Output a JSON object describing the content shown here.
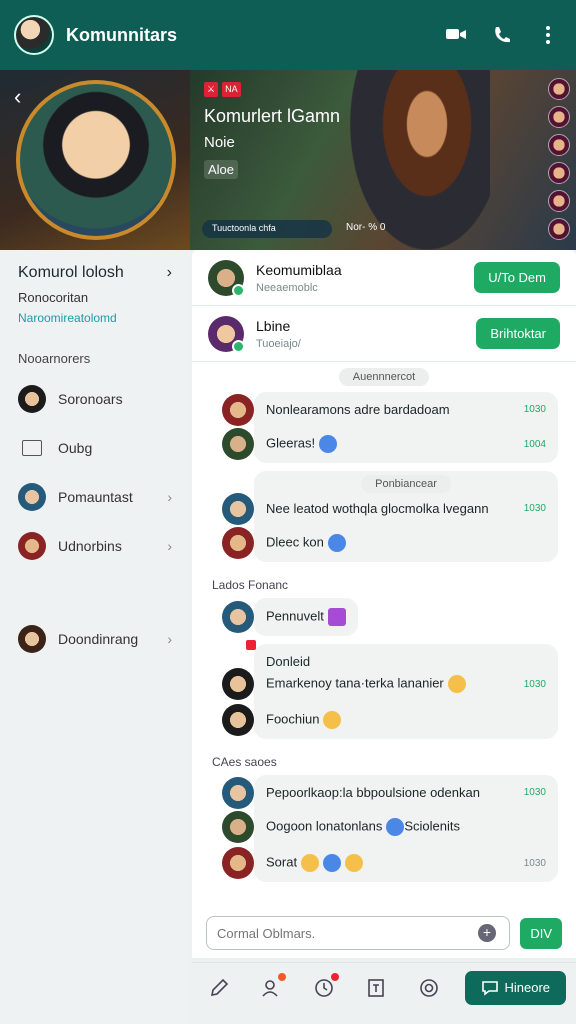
{
  "header": {
    "title": "Komunnitars"
  },
  "profile": {
    "name": "Komurol lolosh",
    "subtitle": "Ronocoritan",
    "link": "Naroomireatolomd",
    "section_title": "Nooarnorers",
    "items": [
      {
        "label": "Soronoars",
        "icon": "avatar",
        "chevron": false
      },
      {
        "label": "Oubg",
        "icon": "square-icon",
        "chevron": false
      },
      {
        "label": "Pomauntast",
        "icon": "avatar",
        "chevron": true
      },
      {
        "label": "Udnorbins",
        "icon": "avatar",
        "chevron": true
      },
      {
        "label": "Doondinrang",
        "icon": "avatar",
        "chevron": true
      }
    ]
  },
  "banner": {
    "badges": [
      "⚔",
      "NA"
    ],
    "title": "Komurlert lGamn",
    "subtitle": "Noie",
    "tag": "Aloe",
    "chip": "Tuuctoonla chfa",
    "stat": "Nor- % 0"
  },
  "contacts": [
    {
      "name": "Keomumiblaa",
      "status": "Neeaemoblc",
      "action": "U/To Dem"
    },
    {
      "name": "Lbine",
      "status": "Tuoeiajo/",
      "action": "Brihtoktar"
    }
  ],
  "chat": {
    "separator": "Auennnercot",
    "threads": [
      {
        "messages": [
          {
            "text": "Nonlearamons adre bardadoam",
            "time": "1030",
            "emoji": ""
          },
          {
            "text": "Gleeras!",
            "time": "1004",
            "emoji": "blue"
          }
        ]
      },
      {
        "header": "Ponbiancear",
        "messages": [
          {
            "text": "Nee leatod wothqla glocmolka lvegann",
            "time": "1030",
            "emoji": ""
          },
          {
            "text": "Dleec kon",
            "time": "",
            "emoji": "blue"
          }
        ]
      }
    ],
    "section_label": "Lados Fonanc",
    "single": {
      "text": "Pennuvelt",
      "emoji": "purple"
    },
    "thread3": {
      "header": "Donleid",
      "messages": [
        {
          "text": "Emarkenoy tana·terka lananier",
          "time": "1030",
          "emoji": "yellow"
        },
        {
          "text": "Foochiun",
          "time": "",
          "emoji": "yellow"
        }
      ]
    },
    "section_label2": "CAes saoes",
    "thread4": {
      "messages": [
        {
          "text": "Pepoorlkaop:la bbpoulsione odenkan",
          "time": "1030",
          "emoji": ""
        },
        {
          "text": "Oogoon lonatonlans",
          "suffix": "Sciolenits",
          "time": "",
          "emoji": "blue"
        },
        {
          "text": "Sorat",
          "time": "1030",
          "emoji": "yellow"
        }
      ]
    }
  },
  "composer": {
    "placeholder": "Cormal Oblmars.",
    "send_label": "DIV"
  },
  "bottom_nav": {
    "primary_label": "Hineore"
  },
  "colors": {
    "accent": "#1faa64",
    "header": "#0e5e55",
    "primary": "#0e6b5c"
  }
}
